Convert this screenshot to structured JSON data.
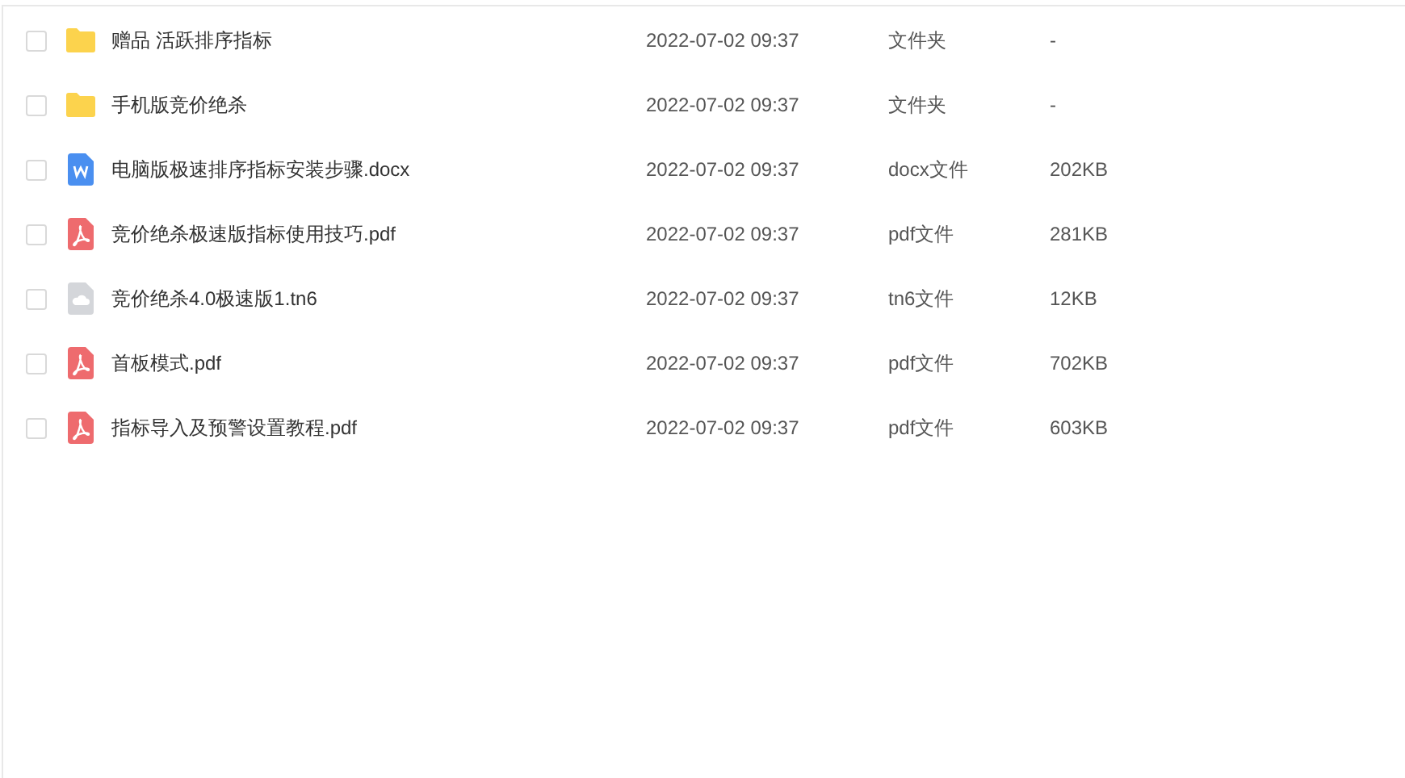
{
  "files": [
    {
      "kind": "folder",
      "checked": false,
      "name": "赠品 活跃排序指标",
      "modified": "2022-07-02 09:37",
      "type": "文件夹",
      "size": "-"
    },
    {
      "kind": "folder",
      "checked": false,
      "name": "手机版竞价绝杀",
      "modified": "2022-07-02 09:37",
      "type": "文件夹",
      "size": "-"
    },
    {
      "kind": "word",
      "checked": false,
      "name": "电脑版极速排序指标安装步骤.docx",
      "modified": "2022-07-02 09:37",
      "type": "docx文件",
      "size": "202KB"
    },
    {
      "kind": "pdf",
      "checked": false,
      "name": "竞价绝杀极速版指标使用技巧.pdf",
      "modified": "2022-07-02 09:37",
      "type": "pdf文件",
      "size": "281KB"
    },
    {
      "kind": "generic",
      "checked": false,
      "name": "竞价绝杀4.0极速版1.tn6",
      "modified": "2022-07-02 09:37",
      "type": "tn6文件",
      "size": "12KB"
    },
    {
      "kind": "pdf",
      "checked": false,
      "name": "首板模式.pdf",
      "modified": "2022-07-02 09:37",
      "type": "pdf文件",
      "size": "702KB"
    },
    {
      "kind": "pdf",
      "checked": false,
      "name": "指标导入及预警设置教程.pdf",
      "modified": "2022-07-02 09:37",
      "type": "pdf文件",
      "size": "603KB"
    }
  ]
}
